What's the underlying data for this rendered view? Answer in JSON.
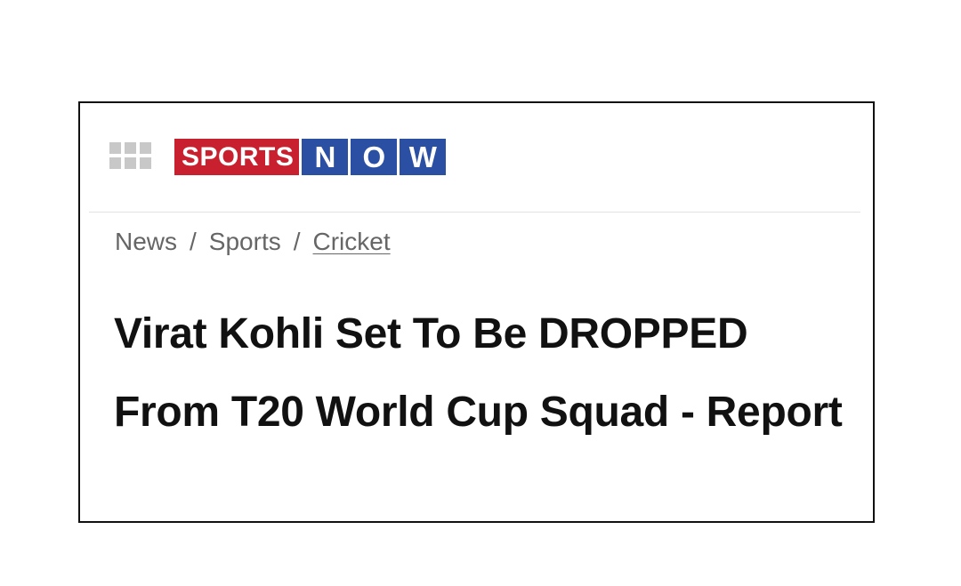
{
  "header": {
    "menu_icon": "grid-menu-icon",
    "logo": {
      "sports": "SPORTS",
      "now_letters": [
        "N",
        "O",
        "W"
      ],
      "colors": {
        "sports_bg": "#c8202f",
        "now_bg": "#2a4fa3"
      }
    }
  },
  "breadcrumb": {
    "items": [
      "News",
      "Sports",
      "Cricket"
    ],
    "separator": "/"
  },
  "article": {
    "headline": "Virat Kohli Set To Be DROPPED From T20 World Cup Squad - Report"
  }
}
